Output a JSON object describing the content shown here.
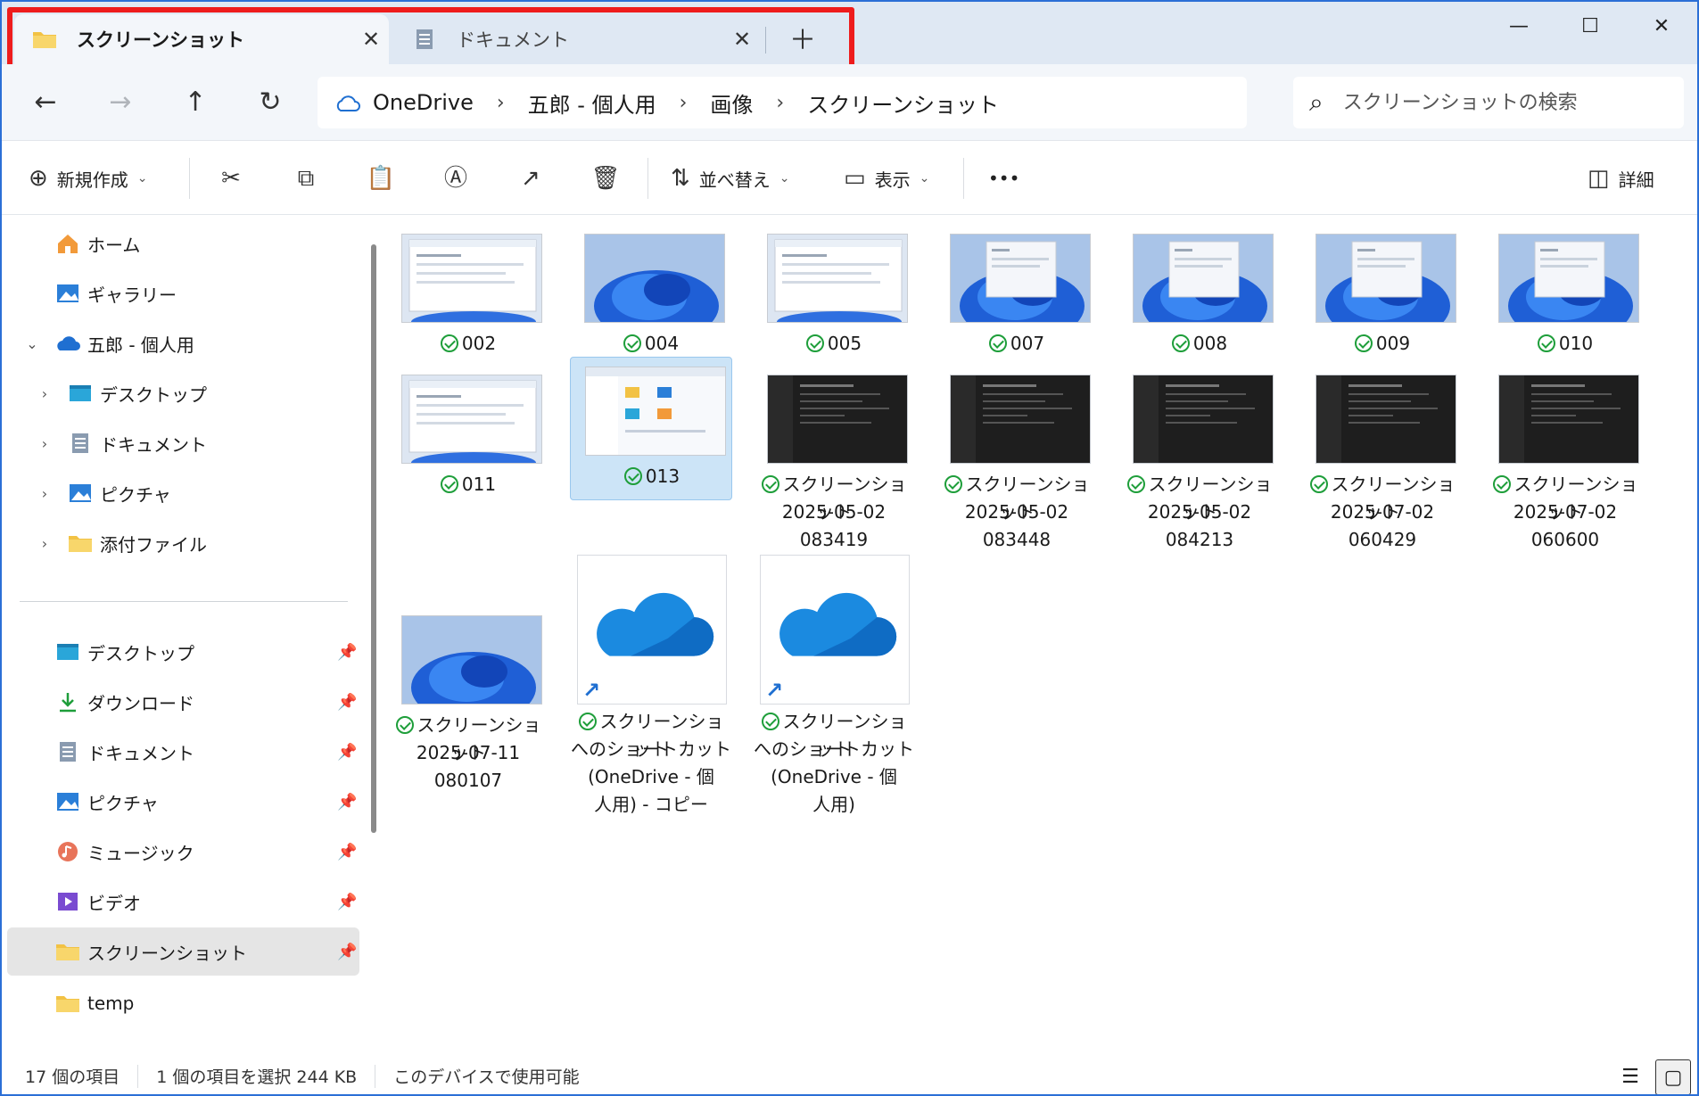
{
  "tabs": [
    {
      "label": "スクリーンショット",
      "icon": "folder-icon",
      "active": true
    },
    {
      "label": "ドキュメント",
      "icon": "document-icon",
      "active": false
    }
  ],
  "tab_close_glyph": "✕",
  "new_tab_glyph": "＋",
  "window_controls": {
    "minimize": "—",
    "maximize": "☐",
    "close": "✕"
  },
  "nav": {
    "back": "←",
    "forward": "→",
    "up": "↑",
    "refresh": "↻"
  },
  "breadcrumb": [
    "OneDrive",
    "五郎 - 個人用",
    "画像",
    "スクリーンショット"
  ],
  "breadcrumb_sep": "›",
  "search": {
    "placeholder": "スクリーンショットの検索"
  },
  "toolbar": {
    "new_label": "新規作成",
    "sort_label": "並べ替え",
    "view_label": "表示",
    "more": "•••",
    "details_label": "詳細"
  },
  "sidebar": {
    "top": [
      {
        "label": "ホーム",
        "icon": "home-icon"
      },
      {
        "label": "ギャラリー",
        "icon": "gallery-icon"
      },
      {
        "label": "五郎 - 個人用",
        "icon": "onedrive-icon",
        "expanded": true
      },
      {
        "label": "デスクトップ",
        "icon": "desktop-icon"
      },
      {
        "label": "ドキュメント",
        "icon": "document-icon"
      },
      {
        "label": "ピクチャ",
        "icon": "pictures-icon"
      },
      {
        "label": "添付ファイル",
        "icon": "folder-icon"
      }
    ],
    "quick": [
      {
        "label": "デスクトップ",
        "icon": "desktop-icon",
        "pinned": true
      },
      {
        "label": "ダウンロード",
        "icon": "download-icon",
        "pinned": true
      },
      {
        "label": "ドキュメント",
        "icon": "document-icon",
        "pinned": true
      },
      {
        "label": "ピクチャ",
        "icon": "pictures-icon",
        "pinned": true
      },
      {
        "label": "ミュージック",
        "icon": "music-icon",
        "pinned": true
      },
      {
        "label": "ビデオ",
        "icon": "video-icon",
        "pinned": true
      },
      {
        "label": "スクリーンショット",
        "icon": "folder-icon",
        "pinned": true,
        "selected": true
      },
      {
        "label": "temp",
        "icon": "folder-icon",
        "pinned": false
      }
    ]
  },
  "files": {
    "row1": [
      "002",
      "004",
      "005",
      "007",
      "008",
      "009",
      "010"
    ],
    "row2": [
      {
        "lines": [
          "011"
        ]
      },
      {
        "lines": [
          "013"
        ],
        "selected": true
      },
      {
        "lines": [
          "スクリーンショット",
          "2025-05-02",
          "083419"
        ]
      },
      {
        "lines": [
          "スクリーンショット",
          "2025-05-02",
          "083448"
        ]
      },
      {
        "lines": [
          "スクリーンショット",
          "2025-05-02",
          "084213"
        ]
      },
      {
        "lines": [
          "スクリーンショット",
          "2025-07-02",
          "060429"
        ]
      },
      {
        "lines": [
          "スクリーンショット",
          "2025-07-02",
          "060600"
        ]
      }
    ],
    "row3": [
      {
        "lines": [
          "スクリーンショット",
          "2025-07-11",
          "080107"
        ]
      },
      {
        "lines": [
          "スクリーンショット",
          "へのショートカット",
          "(OneDrive - 個",
          "人用) - コピー"
        ]
      },
      {
        "lines": [
          "スクリーンショット",
          "へのショートカット",
          "(OneDrive - 個",
          "人用)"
        ]
      }
    ]
  },
  "status": {
    "count": "17 個の項目",
    "selection": "1 個の項目を選択  244 KB",
    "availability": "このデバイスで使用可能"
  },
  "colors": {
    "accent": "#1f6fd1",
    "sync_check": "#1e9e3a",
    "highlight": "#ee1c1c",
    "selected_bg": "#cce4f7"
  }
}
